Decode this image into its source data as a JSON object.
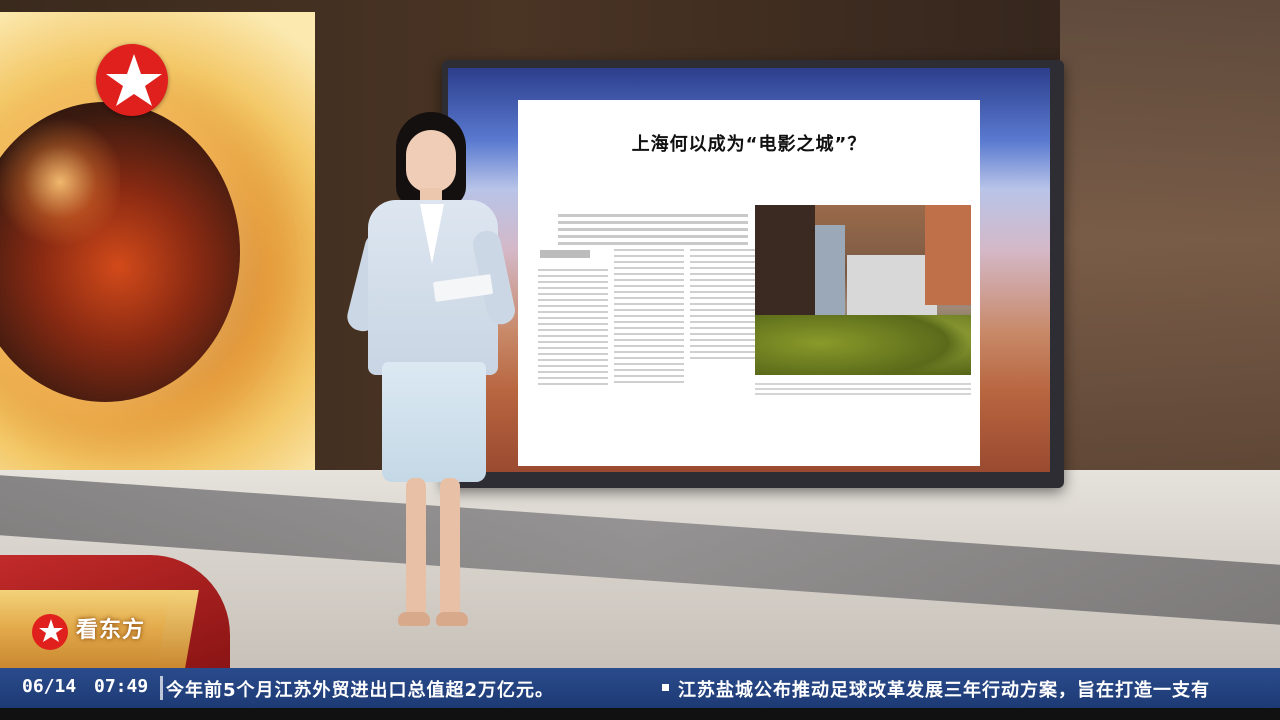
{
  "broadcast": {
    "channel_logo": "star-icon",
    "program_name": "看东方",
    "screen_headline": "上海何以成为“电影之城”？"
  },
  "ticker": {
    "date": "06/14",
    "time": "07:49",
    "headline_1": "今年前5个月江苏外贸进出口总值超2万亿元。",
    "headline_2": "江苏盐城公布推动足球改革发展三年行动方案，旨在打造一支有"
  },
  "colors": {
    "brand_red": "#e0201c",
    "ticker_blue": "#1d3a74",
    "program_gold": "#e2a94a"
  }
}
